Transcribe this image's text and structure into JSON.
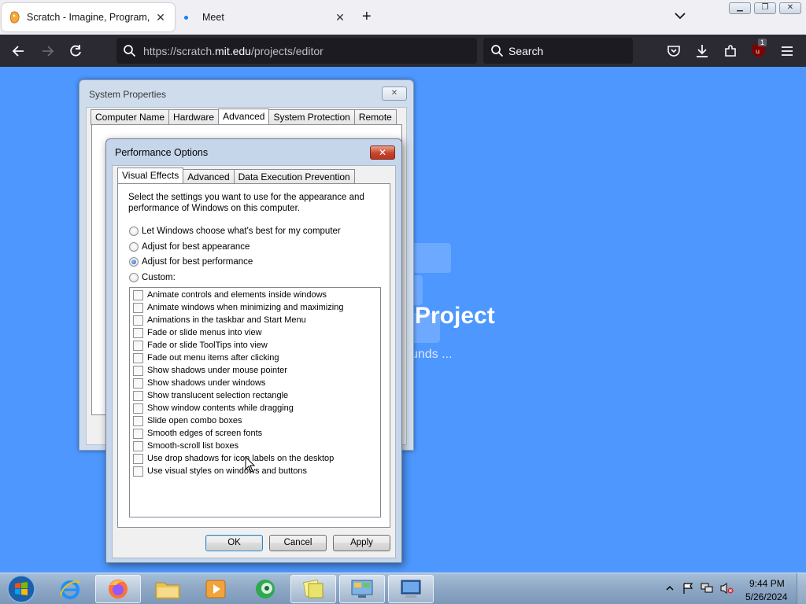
{
  "browser": {
    "tabs": [
      {
        "title": "Scratch - Imagine, Program, Share",
        "active": true
      },
      {
        "title": "Meet",
        "active": false
      }
    ],
    "url_prefix": "https://scratch.",
    "url_host": "mit.edu",
    "url_path": "/projects/editor",
    "search_placeholder": "Search",
    "extension_badge": "1"
  },
  "page": {
    "heading": "Project",
    "subtext": "unds ..."
  },
  "system_properties": {
    "title": "System Properties",
    "tabs": [
      "Computer Name",
      "Hardware",
      "Advanced",
      "System Protection",
      "Remote"
    ],
    "selected_tab": "Advanced"
  },
  "performance_options": {
    "title": "Performance Options",
    "tabs": [
      "Visual Effects",
      "Advanced",
      "Data Execution Prevention"
    ],
    "selected_tab": "Visual Effects",
    "description": "Select the settings you want to use for the appearance and performance of Windows on this computer.",
    "radios": [
      {
        "label": "Let Windows choose what's best for my computer",
        "checked": false
      },
      {
        "label": "Adjust for best appearance",
        "checked": false
      },
      {
        "label": "Adjust for best performance",
        "checked": true
      },
      {
        "label": "Custom:",
        "checked": false
      }
    ],
    "effects": [
      {
        "label": "Animate controls and elements inside windows",
        "checked": false
      },
      {
        "label": "Animate windows when minimizing and maximizing",
        "checked": false
      },
      {
        "label": "Animations in the taskbar and Start Menu",
        "checked": false
      },
      {
        "label": "Fade or slide menus into view",
        "checked": false
      },
      {
        "label": "Fade or slide ToolTips into view",
        "checked": false
      },
      {
        "label": "Fade out menu items after clicking",
        "checked": false
      },
      {
        "label": "Show shadows under mouse pointer",
        "checked": false
      },
      {
        "label": "Show shadows under windows",
        "checked": false
      },
      {
        "label": "Show translucent selection rectangle",
        "checked": false
      },
      {
        "label": "Show window contents while dragging",
        "checked": false
      },
      {
        "label": "Slide open combo boxes",
        "checked": false
      },
      {
        "label": "Smooth edges of screen fonts",
        "checked": false
      },
      {
        "label": "Smooth-scroll list boxes",
        "checked": false
      },
      {
        "label": "Use drop shadows for icon labels on the desktop",
        "checked": false
      },
      {
        "label": "Use visual styles on windows and buttons",
        "checked": false
      }
    ],
    "buttons": {
      "ok": "OK",
      "cancel": "Cancel",
      "apply": "Apply"
    }
  },
  "taskbar": {
    "time": "9:44 PM",
    "date": "5/26/2024"
  },
  "colors": {
    "scratch_blue": "#4d97ff",
    "browser_dark": "#2b2a33",
    "close_red": "#c7432b"
  }
}
